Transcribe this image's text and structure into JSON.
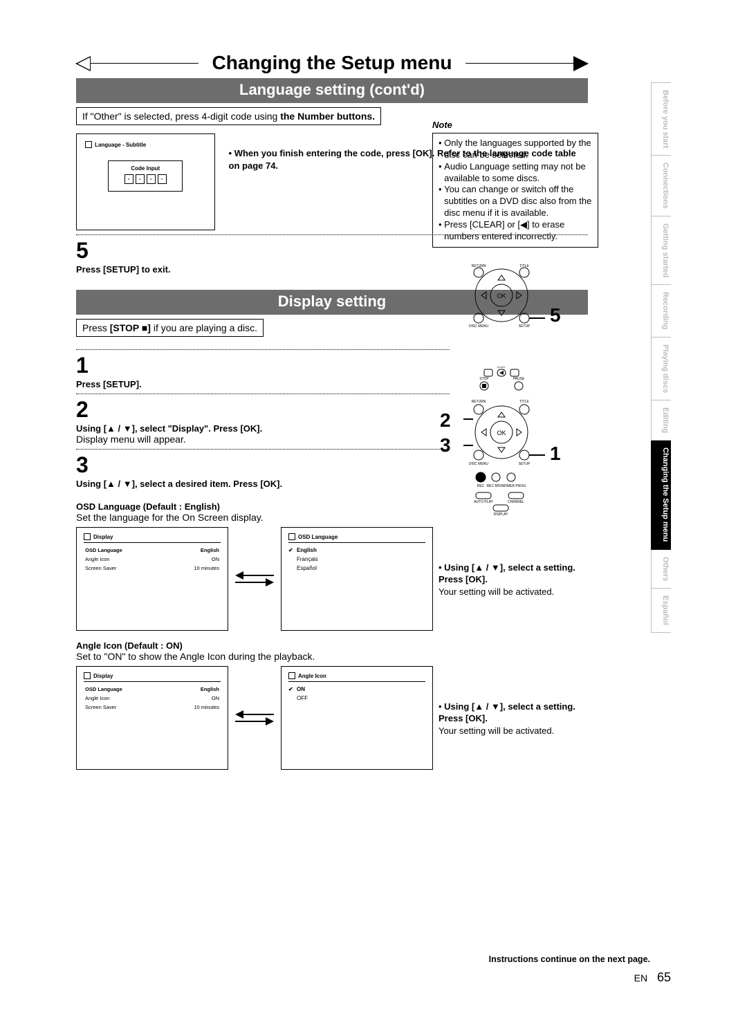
{
  "page_title": "Changing the Setup menu",
  "section1_title": "Language setting (cont'd)",
  "intro_prefix": "If \"Other\" is selected, press 4-digit code using ",
  "intro_bold": "the Number buttons.",
  "code_panel": {
    "header": "Language - Subtitle",
    "label": "Code Input",
    "cells": [
      "-",
      "-",
      "-",
      "-"
    ]
  },
  "finish_text": "• When you finish entering the code, press [OK]. Refer to the language code table on page 74.",
  "note": {
    "title": "Note",
    "items": [
      "Only the languages supported by the disc can be selected.",
      "Audio Language setting may not be available to some discs.",
      "You can change or switch off the subtitles on a DVD disc also from the disc menu if it is available.",
      "Press [CLEAR] or [◀] to erase numbers entered incorrectly."
    ]
  },
  "step5_num": "5",
  "step5_text": "Press [SETUP] to exit.",
  "section2_title": "Display setting",
  "display_intro_prefix": "Press ",
  "display_intro_bold": "[STOP ■]",
  "display_intro_suffix": " if you are playing a disc.",
  "d_step1_num": "1",
  "d_step1_text": "Press [SETUP].",
  "d_step2_num": "2",
  "d_step2_text": "Using [▲ / ▼], select \"Display\". Press [OK].",
  "d_step2_body": "Display menu will appear.",
  "d_step3_num": "3",
  "d_step3_text": "Using [▲ / ▼], select a desired item. Press [OK].",
  "osd_heading": "OSD Language (Default : English)",
  "osd_body": "Set the language for the On Screen display.",
  "display_menu": {
    "header": "Display",
    "rows": [
      {
        "label": "OSD Language",
        "value": "English"
      },
      {
        "label": "Angle Icon",
        "value": "ON"
      },
      {
        "label": "Screen Saver",
        "value": "10 minutes"
      }
    ]
  },
  "osd_lang_menu": {
    "header": "OSD Language",
    "options": [
      {
        "label": "English",
        "checked": true
      },
      {
        "label": "Français",
        "checked": false
      },
      {
        "label": "Español",
        "checked": false
      }
    ]
  },
  "right_step_a": {
    "bold": "• Using [▲ / ▼], select a setting. Press [OK].",
    "body": "Your setting will be activated."
  },
  "angle_heading": "Angle Icon (Default : ON)",
  "angle_body": "Set to \"ON\" to show the Angle Icon during the playback.",
  "angle_menu": {
    "header": "Angle Icon",
    "options": [
      {
        "label": "ON",
        "checked": true
      },
      {
        "label": "OFF",
        "checked": false
      }
    ]
  },
  "right_step_b": {
    "bold": "• Using [▲ / ▼], select a setting. Press [OK].",
    "body": "Your setting will be activated."
  },
  "continue_text": "Instructions continue on the next page.",
  "footer_lang": "EN",
  "footer_page": "65",
  "tabs": [
    "Before you start",
    "Connections",
    "Getting started",
    "Recording",
    "Playing discs",
    "Editing",
    "Changing the Setup menu",
    "Others",
    "Español"
  ],
  "tabs_active_index": 6,
  "remote_callouts": {
    "top": "5",
    "mid_left_top": "2",
    "mid_left_bot": "3",
    "mid_right": "1"
  }
}
